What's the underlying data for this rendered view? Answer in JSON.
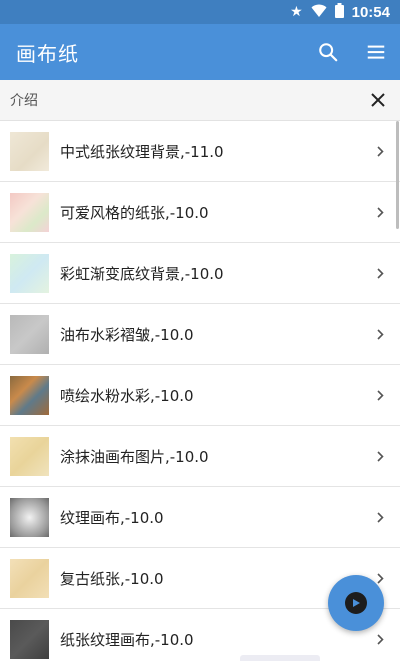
{
  "status_bar": {
    "time": "10:54",
    "icons": [
      "star-icon",
      "wifi-icon",
      "battery-icon"
    ]
  },
  "app_bar": {
    "title": "画布纸",
    "actions": [
      "search-icon",
      "menu-icon"
    ]
  },
  "intro": {
    "label": "介绍"
  },
  "items": [
    {
      "title": "中式纸张纹理背景,-11.0",
      "thumb": "linear-gradient(135deg,#efe7d6,#e6dcc6 60%,#f1eadb)"
    },
    {
      "title": "可爱风格的纸张,-10.0",
      "thumb": "linear-gradient(135deg,#f3c9c4,#f7e2d8 40%,#dbe9c9 70%,#f4d2d6)"
    },
    {
      "title": "彩虹渐变底纹背景,-10.0",
      "thumb": "linear-gradient(135deg,#d8f2dc,#cfe9f2 50%,#e4f3e0)"
    },
    {
      "title": "油布水彩褶皱,-10.0",
      "thumb": "linear-gradient(135deg,#b9b9b9,#c8c8c8 50%,#b0b0b0)"
    },
    {
      "title": "喷绘水粉水彩,-10.0",
      "thumb": "linear-gradient(135deg,#8a6a3f,#c98a4b 35%,#5f7a8a 60%,#a06a3a)"
    },
    {
      "title": "涂抹油画布图片,-10.0",
      "thumb": "linear-gradient(135deg,#f2e0b0,#e9d49a 50%,#f0e3bd)"
    },
    {
      "title": "纹理画布,-10.0",
      "thumb": "radial-gradient(circle at 50% 50%,#f2f2f2,#9a9a9a 70%,#6a6a6a)"
    },
    {
      "title": "复古纸张,-10.0",
      "thumb": "linear-gradient(135deg,#f3e0b8,#ead29e 50%,#f2dfb6)"
    },
    {
      "title": "纸张纹理画布,-10.0",
      "thumb": "linear-gradient(135deg,#4a4a4a,#5a5a5a 50%,#3f3f3f)"
    }
  ],
  "colors": {
    "status_bar": "#3f7fc0",
    "app_bar": "#4a90d9",
    "fab": "#4a90d9"
  },
  "fab": {
    "icon": "play-icon"
  }
}
